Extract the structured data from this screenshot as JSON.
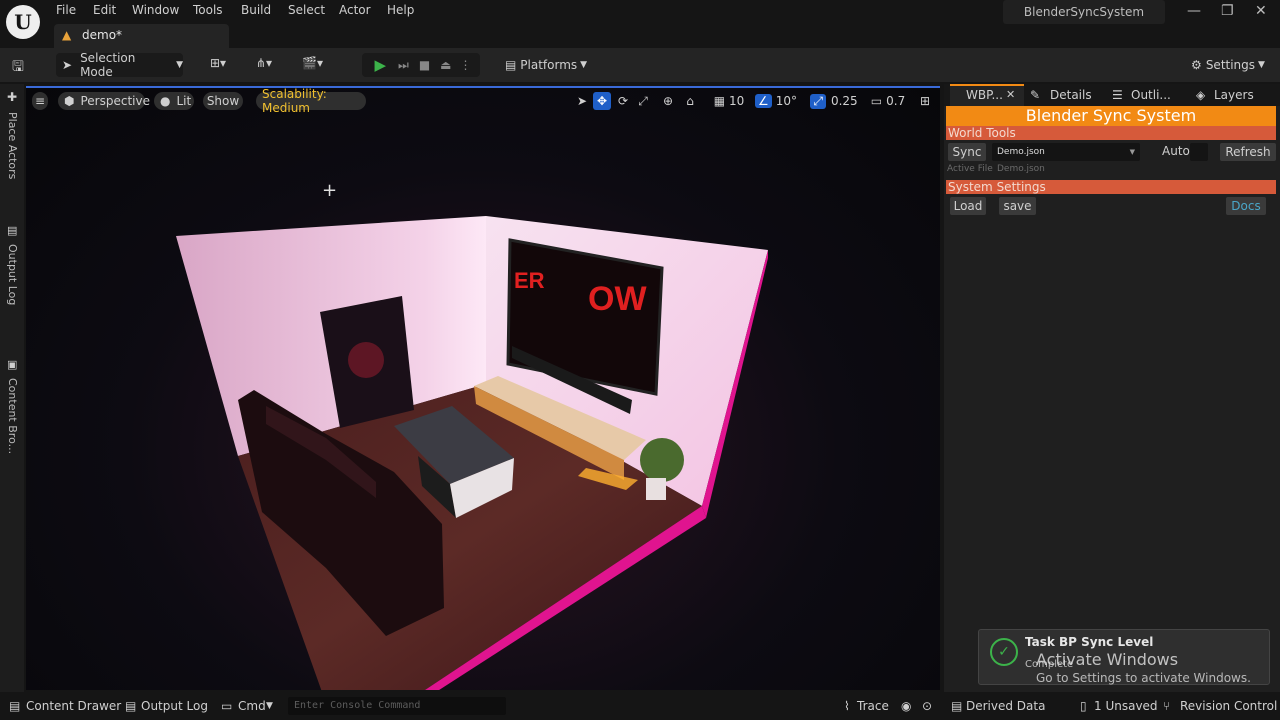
{
  "menu": [
    "File",
    "Edit",
    "Window",
    "Tools",
    "Build",
    "Select",
    "Actor",
    "Help"
  ],
  "doc_tab": "demo*",
  "project_name": "BlenderSyncSystem",
  "toolbar": {
    "selection_mode": "Selection Mode",
    "platforms": "Platforms",
    "settings": "Settings"
  },
  "left_strip": [
    "Place Actors",
    "Output Log",
    "Content Bro..."
  ],
  "viewport": {
    "perspective": "Perspective",
    "lit": "Lit",
    "show": "Show",
    "scalability": "Scalability: Medium",
    "grid_snap": "10",
    "rot_snap": "10°",
    "scale_snap": "0.25",
    "cam_speed": "0.7",
    "tv_text_left": "ER",
    "tv_text_right": "OW"
  },
  "right_panel": {
    "tabs": [
      "WBP...",
      "Details",
      "Outli...",
      "Layers"
    ],
    "banner": "Blender Sync System",
    "world_tools": "World Tools",
    "sync": "Sync",
    "file": "Demo.json",
    "auto": "Auto",
    "refresh": "Refresh",
    "active_file_label": "Active File",
    "active_file_value": "Demo.json",
    "system_settings": "System Settings",
    "load": "Load",
    "save": "save",
    "docs": "Docs"
  },
  "toast": {
    "title": "Task BP Sync Level",
    "status": "Complete"
  },
  "watermark": {
    "line1": "Activate Windows",
    "line2": "Go to Settings to activate Windows."
  },
  "statusbar": {
    "content_drawer": "Content Drawer",
    "output_log": "Output Log",
    "cmd": "Cmd",
    "console_placeholder": "Enter Console Command",
    "trace": "Trace",
    "derived_data": "Derived Data",
    "unsaved": "1 Unsaved",
    "revision_control": "Revision Control"
  },
  "colors": {
    "accent_orange": "#f28a14",
    "section_red": "#d65a3a",
    "select_blue": "#1f5fc8",
    "play_green": "#3cb34a"
  }
}
